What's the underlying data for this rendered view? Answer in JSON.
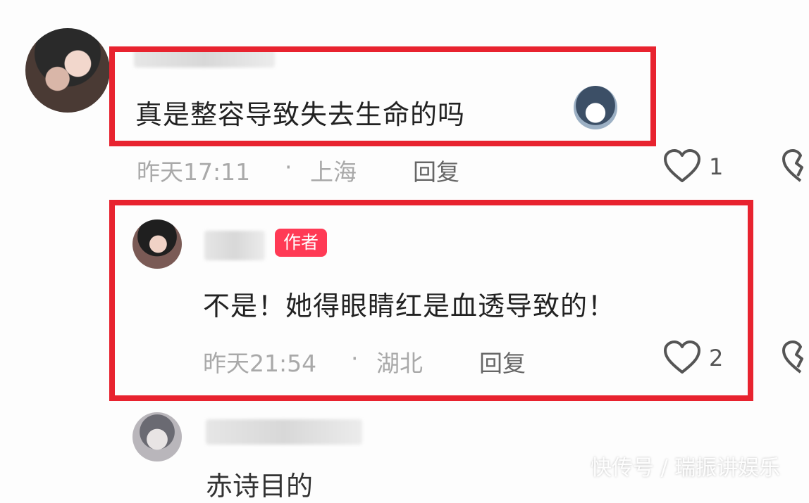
{
  "comments": [
    {
      "text": "真是整容导致失去生命的吗",
      "time": "昨天17:11",
      "location": "上海",
      "reply_label": "回复",
      "like_count": "1"
    },
    {
      "author_badge": "作者",
      "text": "不是！她得眼睛红是血透导致的！",
      "time": "昨天21:54",
      "location": "湖北",
      "reply_label": "回复",
      "like_count": "2"
    }
  ],
  "separator": "·",
  "partial_third_comment": "赤诗目的",
  "watermark": "快传号 / 瑞振讲娱乐",
  "icons": {
    "like": "heart-outline-icon",
    "dislike": "broken-heart-icon",
    "emoji": "husky-dog-emoji-icon"
  },
  "colors": {
    "highlight_border": "#e8232f",
    "author_badge": "#ff3a55",
    "meta_text": "#a9a9a9"
  }
}
